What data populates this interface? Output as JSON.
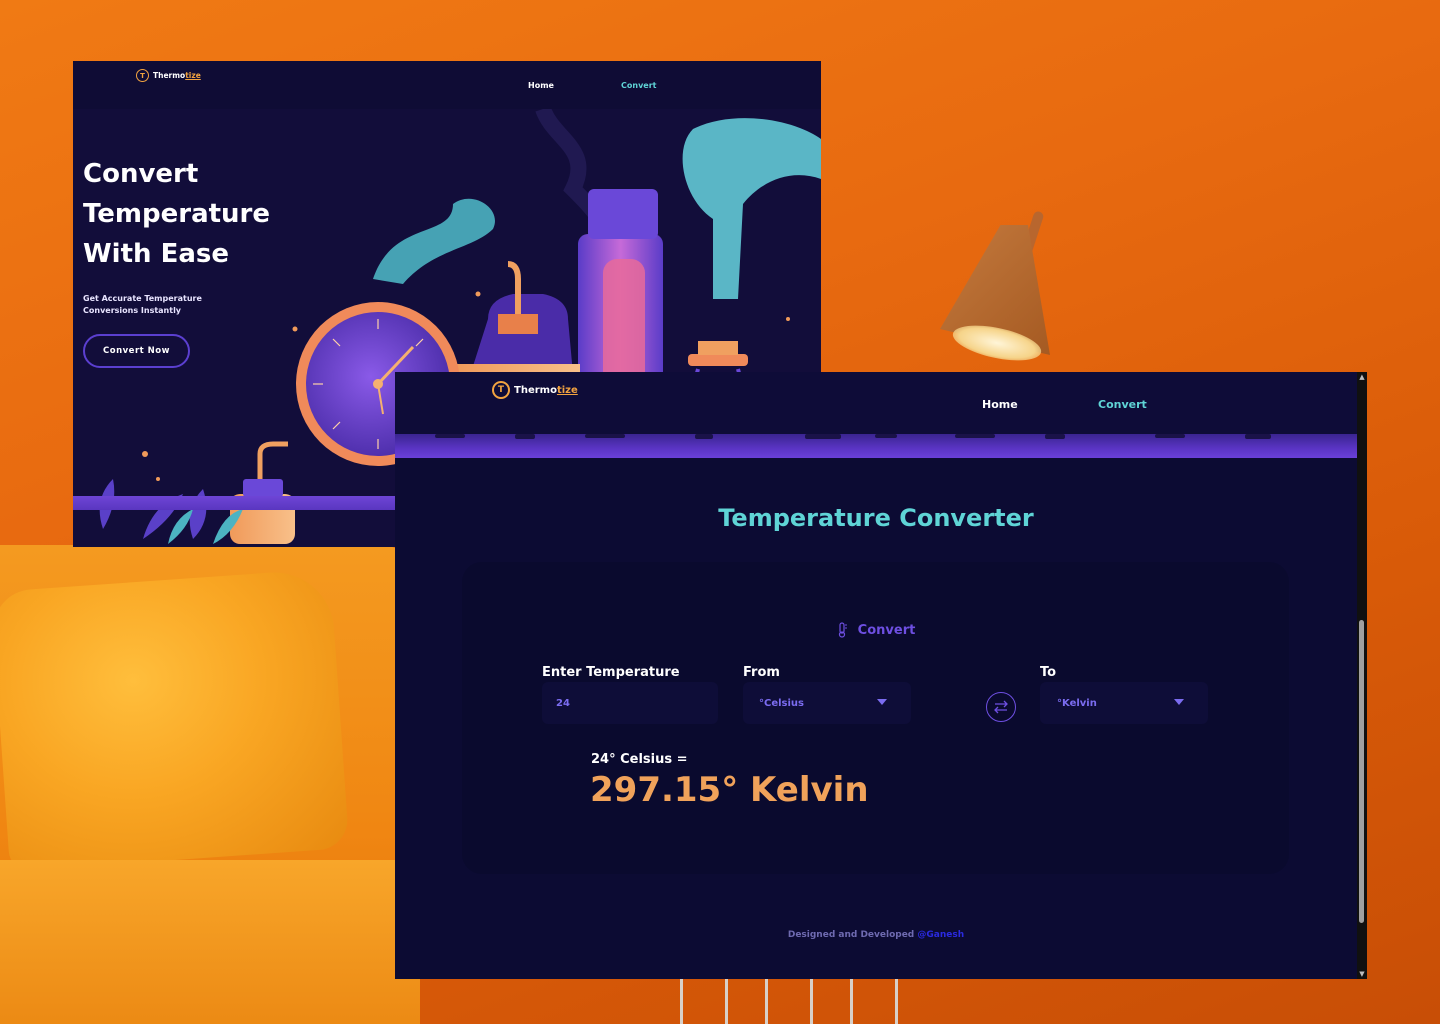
{
  "back_window": {
    "logo": {
      "icon_letter": "T",
      "name_main": "Thermo",
      "name_accent": "tize"
    },
    "nav": {
      "home": "Home",
      "convert": "Convert"
    },
    "hero": {
      "title_line1": "Convert",
      "title_line2": "Temperature",
      "title_line3": "With Ease",
      "subtitle_line1": "Get Accurate Temperature",
      "subtitle_line2": "Conversions Instantly",
      "cta": "Convert Now"
    }
  },
  "front_window": {
    "logo": {
      "icon_letter": "T",
      "name_main": "Thermo",
      "name_accent": "tize"
    },
    "nav": {
      "home": "Home",
      "convert": "Convert"
    },
    "title": "Temperature Converter",
    "card": {
      "heading": "Convert",
      "heading_icon": "thermometer-icon",
      "input_label": "Enter Temperature",
      "input_value": "24",
      "from_label": "From",
      "from_value": "°Celsius",
      "to_label": "To",
      "to_value": "°Kelvin",
      "swap_icon": "swap-arrows-icon",
      "result_line": "24° Celsius =",
      "result_value": "297.15° Kelvin"
    },
    "footer": {
      "text": "Designed and Developed ",
      "author": "@Ganesh"
    }
  },
  "colors": {
    "accent_teal": "#5fd4d6",
    "accent_orange": "#f0a25a",
    "accent_purple": "#6e4fe2",
    "page_bg": "#0c0b33"
  }
}
